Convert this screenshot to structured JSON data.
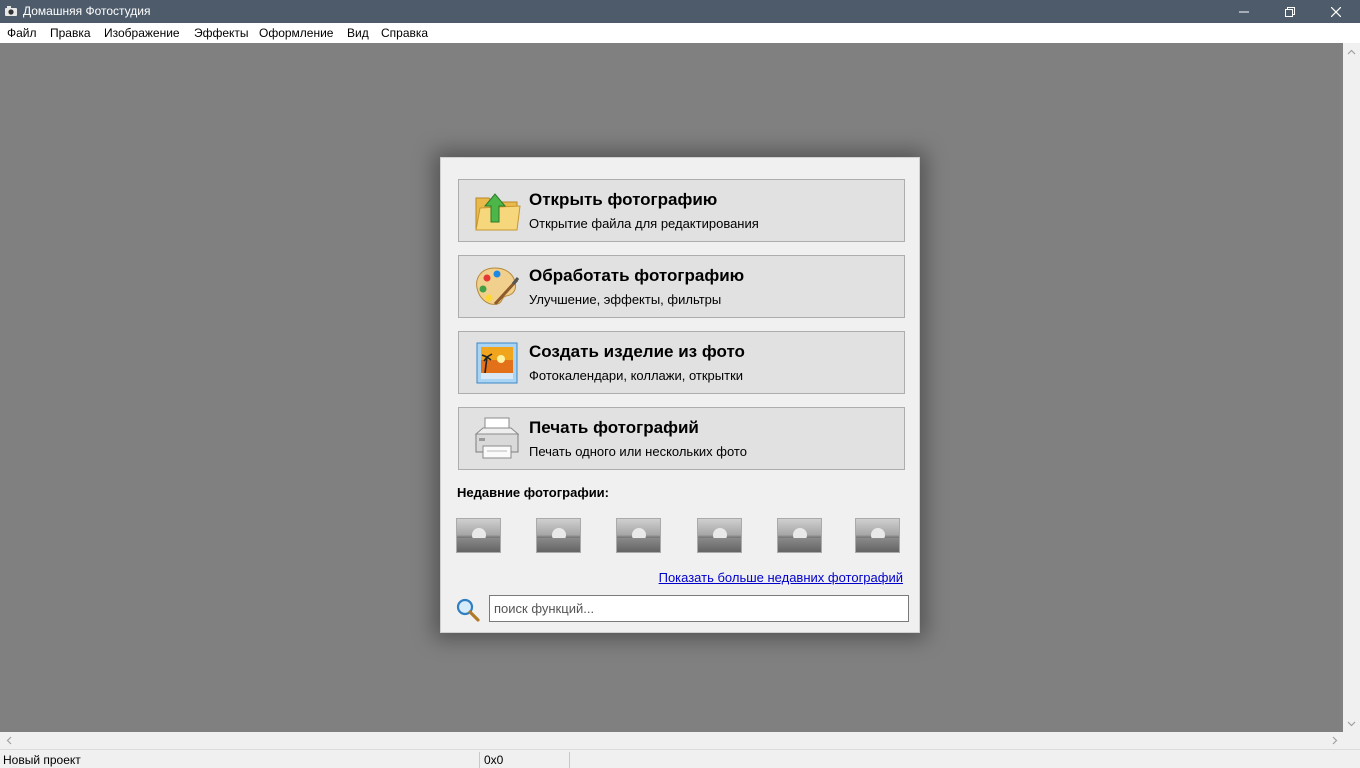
{
  "window": {
    "title": "Домашняя Фотостудия",
    "icons": {
      "app": "camera-icon",
      "minimize": "minimize-icon",
      "maximize": "restore-icon",
      "close": "close-icon"
    }
  },
  "menu": [
    "Файл",
    "Правка",
    "Изображение",
    "Эффекты",
    "Оформление",
    "Вид",
    "Справка"
  ],
  "start_dialog": {
    "actions": [
      {
        "title": "Открыть фотографию",
        "subtitle": "Открытие файла для редактирования",
        "icon": "open-folder-icon"
      },
      {
        "title": "Обработать фотографию",
        "subtitle": "Улучшение, эффекты, фильтры",
        "icon": "palette-icon"
      },
      {
        "title": "Создать изделие из фото",
        "subtitle": "Фотокалендари, коллажи, открытки",
        "icon": "photo-frame-icon"
      },
      {
        "title": "Печать фотографий",
        "subtitle": "Печать одного или нескольких фото",
        "icon": "printer-icon"
      }
    ],
    "recent_label": "Недавние фотографии:",
    "recent_count": 6,
    "more_link": "Показать больше недавних фотографий",
    "search": {
      "placeholder": "поиск функций...",
      "value": "",
      "icon": "search-icon"
    }
  },
  "statusbar": {
    "project": "Новый проект",
    "size": "0x0"
  },
  "colors": {
    "titlebar": "#4d5b6a",
    "workspace": "#808080",
    "dialog": "#f0f0f0",
    "button": "#e1e1e1",
    "link": "#0000cc"
  }
}
